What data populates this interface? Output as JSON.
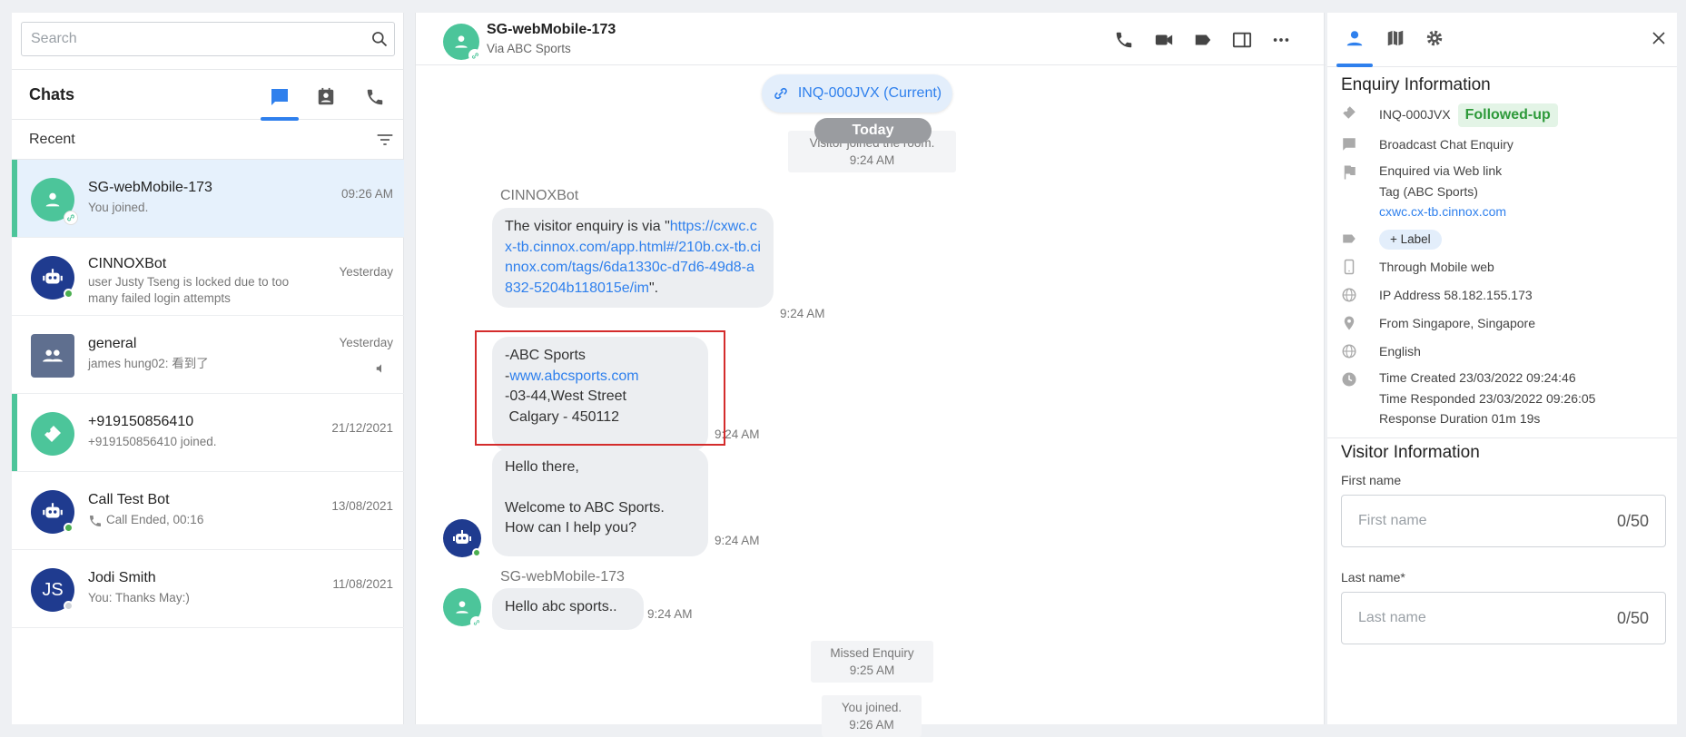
{
  "search": {
    "placeholder": "Search"
  },
  "left": {
    "title": "Chats",
    "recent_label": "Recent",
    "chats": [
      {
        "name": "SG-webMobile-173",
        "sub": "You joined.",
        "time": "09:26 AM"
      },
      {
        "name": "CINNOXBot",
        "sub": "user Justy Tseng is locked due to too many failed login attempts",
        "time": "Yesterday"
      },
      {
        "name": "general",
        "sub": "james hung02: 看到了",
        "time": "Yesterday"
      },
      {
        "name": "+919150856410",
        "sub": "+919150856410 joined.",
        "time": "21/12/2021"
      },
      {
        "name": "Call Test Bot",
        "sub": "Call Ended, 00:16",
        "time": "13/08/2021"
      },
      {
        "name": "Jodi Smith",
        "sub": "You: Thanks May:)",
        "time": "11/08/2021",
        "initials": "JS"
      }
    ]
  },
  "conversation": {
    "title": "SG-webMobile-173",
    "subtitle": "Via ABC Sports",
    "inquiry_pill": "INQ-000JVX (Current)",
    "today_label": "Today",
    "sys_joined": {
      "text": "Visitor joined the room.",
      "time": "9:24 AM"
    },
    "bot_sender": "CINNOXBot",
    "msg1": {
      "prefix": "The visitor enquiry is via \"",
      "link": "https://cxwc.cx-tb.cinnox.com/app.html#/210b.cx-tb.cinnox.com/tags/6da1330c-d7d6-49d8-a832-5204b118015e/im",
      "suffix": "\".",
      "time": "9:24 AM"
    },
    "msg2": {
      "line1": "-ABC Sports",
      "line2_prefix": "-",
      "line2_link": "www.abcsports.com",
      "line3": "-03-44,West Street",
      "line4": " Calgary - 450112",
      "time": "9:24 AM"
    },
    "msg3": {
      "line1": "Hello there,",
      "line2": "Welcome to ABC Sports.",
      "line3": "How can I help you?",
      "time": "9:24 AM"
    },
    "visitor_sender": "SG-webMobile-173",
    "msg4": {
      "text": "Hello abc sports..",
      "time": "9:24 AM"
    },
    "sys_missed": {
      "text": "Missed Enquiry",
      "time": "9:25 AM"
    },
    "sys_you_joined": {
      "text": "You joined.",
      "time": "9:26 AM"
    }
  },
  "enquiry": {
    "section_title": "Enquiry Information",
    "id": "INQ-000JVX",
    "status": "Followed-up",
    "type": "Broadcast Chat Enquiry",
    "enquired_via": "Enquired via Web link",
    "tag": "Tag (ABC Sports)",
    "domain_link": "cxwc.cx-tb.cinnox.com",
    "label_button": "+ Label",
    "through": "Through Mobile web",
    "ip": "IP Address 58.182.155.173",
    "location": "From Singapore, Singapore",
    "language": "English",
    "time_created": "Time Created 23/03/2022 09:24:46",
    "time_responded": "Time Responded 23/03/2022 09:26:05",
    "response_duration": "Response Duration 01m 19s"
  },
  "visitor": {
    "section_title": "Visitor Information",
    "first_name_label": "First name",
    "first_name_placeholder": "First name",
    "first_name_count": "0/50",
    "last_name_label": "Last name*",
    "last_name_placeholder": "Last name",
    "last_name_count": "0/50"
  },
  "colors": {
    "accent": "#2f80ed",
    "green_avatar": "#4cc59a",
    "bot_avatar": "#1f3b8f",
    "group_avatar": "#5f6f8f",
    "highlight": "#d42c2c",
    "status_green": "#2e9a3a"
  }
}
